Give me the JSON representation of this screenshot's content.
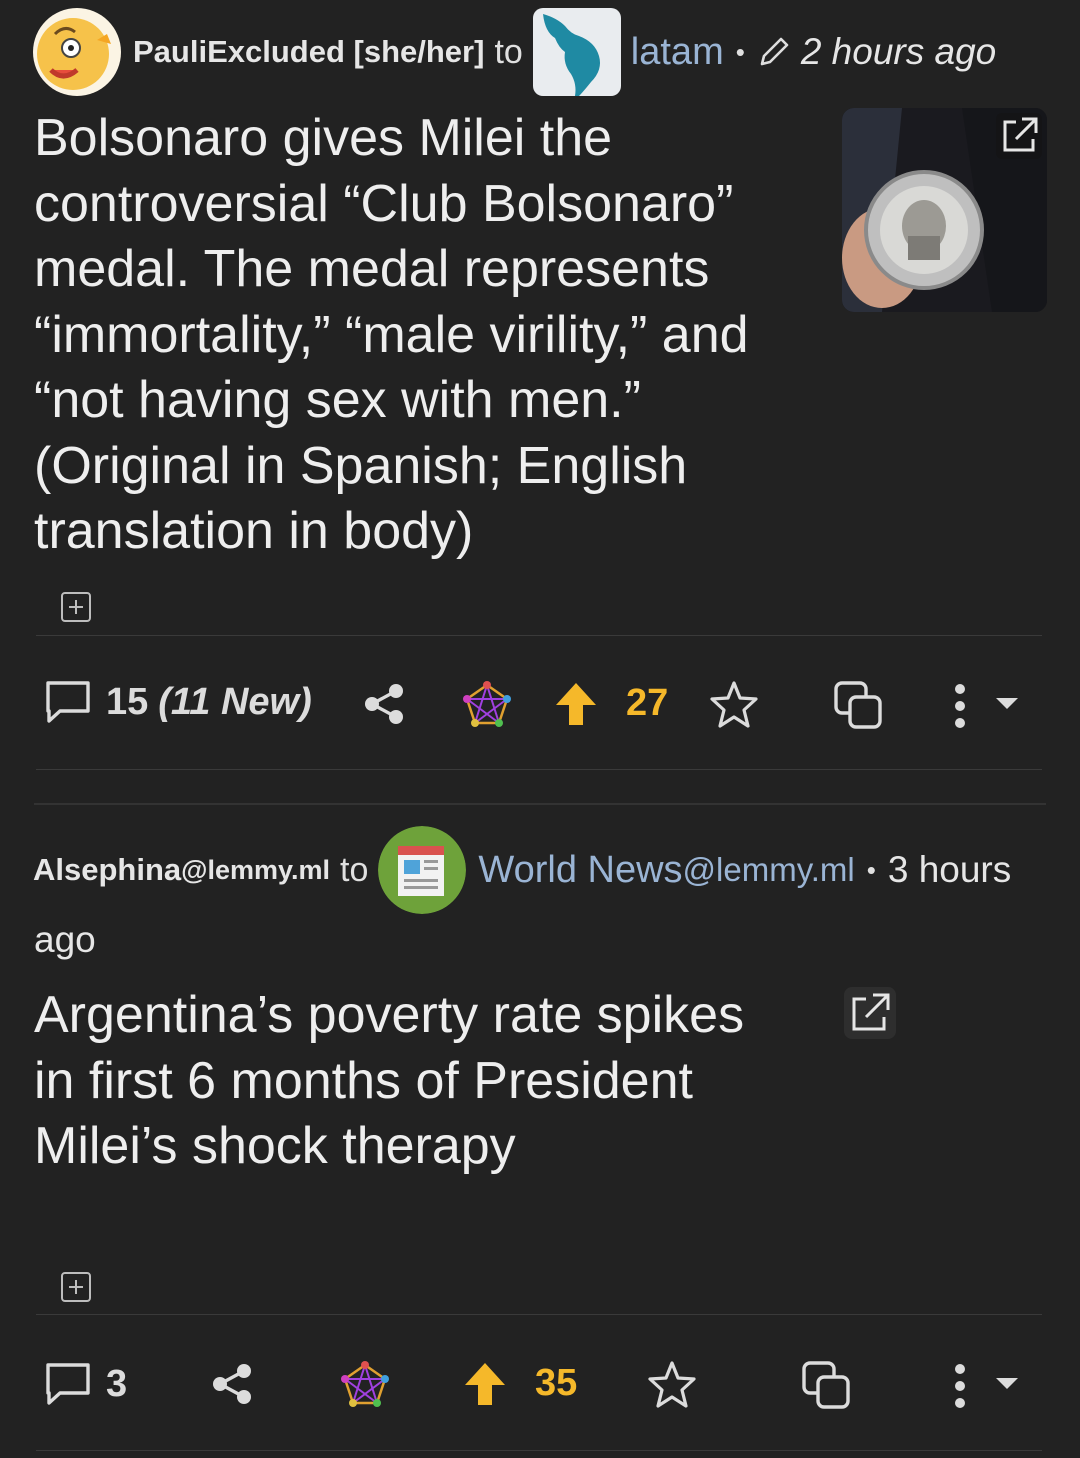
{
  "colors": {
    "background": "#222222",
    "score": "#f5b82a",
    "community": "#9ab4d4",
    "text": "#eeeeee"
  },
  "posts": [
    {
      "author": "PauliExcluded [she/her]",
      "to": "to",
      "community": "latam",
      "edited_icon": "pencil-icon",
      "time": "2 hours ago",
      "title": "Bolsonaro gives Milei the controversial “Club Bolsonaro” medal. The medal represents “immortality,” “male virility,” and “not having sex with men.” (Original in Spanish; English translation in body)",
      "comments": "15",
      "comments_new": "(11 New)",
      "score": "27"
    },
    {
      "author": "Alsephina",
      "author_instance": "@lemmy.ml",
      "to": "to",
      "community": "World News",
      "community_instance": "@lemmy.ml",
      "time_part1": "3 hours",
      "time_part2": "ago",
      "title": "Argentina’s poverty rate spikes in first 6 months of President Milei’s shock therapy",
      "comments": "3",
      "score": "35"
    }
  ],
  "separator": "•"
}
